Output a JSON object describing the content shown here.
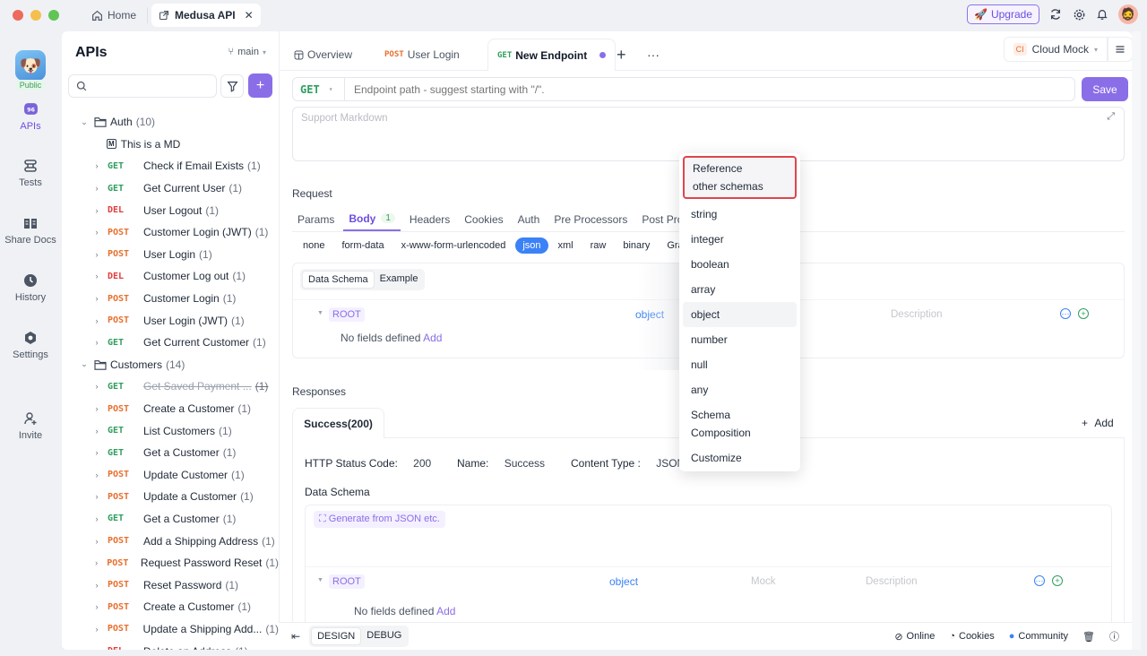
{
  "window": {
    "tabs": [
      {
        "label": "Home",
        "icon": "home-icon"
      },
      {
        "label": "Medusa API",
        "icon": "external-link-icon",
        "active": true
      }
    ],
    "upgrade_label": "Upgrade"
  },
  "rail": {
    "public_badge": "Public",
    "items": [
      {
        "label": "APIs",
        "icon": "api-icon",
        "active": true
      },
      {
        "label": "Tests",
        "icon": "tests-icon"
      },
      {
        "label": "Share Docs",
        "icon": "book-icon"
      },
      {
        "label": "History",
        "icon": "clock-icon"
      },
      {
        "label": "Settings",
        "icon": "settings-icon"
      },
      {
        "label": "Invite",
        "icon": "invite-user-icon"
      }
    ]
  },
  "sidebar": {
    "title": "APIs",
    "branch": "main",
    "search_placeholder": "",
    "tree": [
      {
        "type": "folder",
        "label": "Auth",
        "count": "(10)",
        "expanded": true
      },
      {
        "type": "doc",
        "label": "This is a MD"
      },
      {
        "type": "api",
        "method": "GET",
        "label": "Check if Email Exists",
        "count": "(1)"
      },
      {
        "type": "api",
        "method": "GET",
        "label": "Get Current User",
        "count": "(1)"
      },
      {
        "type": "api",
        "method": "DEL",
        "label": "User Logout",
        "count": "(1)"
      },
      {
        "type": "api",
        "method": "POST",
        "label": "Customer Login (JWT)",
        "count": "(1)"
      },
      {
        "type": "api",
        "method": "POST",
        "label": "User Login",
        "count": "(1)"
      },
      {
        "type": "api",
        "method": "DEL",
        "label": "Customer Log out",
        "count": "(1)"
      },
      {
        "type": "api",
        "method": "POST",
        "label": "Customer Login",
        "count": "(1)"
      },
      {
        "type": "api",
        "method": "POST",
        "label": "User Login (JWT)",
        "count": "(1)"
      },
      {
        "type": "api",
        "method": "GET",
        "label": "Get Current Customer",
        "count": "(1)"
      },
      {
        "type": "folder",
        "label": "Customers",
        "count": "(14)",
        "expanded": true
      },
      {
        "type": "api",
        "method": "GET",
        "label": "Get Saved Payment ...",
        "count": "(1)",
        "deprecated": true
      },
      {
        "type": "api",
        "method": "POST",
        "label": "Create a Customer",
        "count": "(1)"
      },
      {
        "type": "api",
        "method": "GET",
        "label": "List Customers",
        "count": "(1)"
      },
      {
        "type": "api",
        "method": "GET",
        "label": "Get a Customer",
        "count": "(1)"
      },
      {
        "type": "api",
        "method": "POST",
        "label": "Update Customer",
        "count": "(1)"
      },
      {
        "type": "api",
        "method": "POST",
        "label": "Update a Customer",
        "count": "(1)"
      },
      {
        "type": "api",
        "method": "GET",
        "label": "Get a Customer",
        "count": "(1)"
      },
      {
        "type": "api",
        "method": "POST",
        "label": "Add a Shipping Address",
        "count": "(1)"
      },
      {
        "type": "api",
        "method": "POST",
        "label": "Request Password Reset",
        "count": "(1)"
      },
      {
        "type": "api",
        "method": "POST",
        "label": "Reset Password",
        "count": "(1)"
      },
      {
        "type": "api",
        "method": "POST",
        "label": "Create a Customer",
        "count": "(1)"
      },
      {
        "type": "api",
        "method": "POST",
        "label": "Update a Shipping Add...",
        "count": "(1)"
      },
      {
        "type": "api",
        "method": "DEL",
        "label": "Delete an Address",
        "count": "(1)"
      }
    ]
  },
  "main": {
    "tabs": [
      {
        "label": "Overview",
        "icon": "overview-icon"
      },
      {
        "method": "POST",
        "label": "User Login"
      },
      {
        "method": "GET",
        "label": "New Endpoint",
        "active": true,
        "unsaved": true
      }
    ],
    "environment": {
      "badge": "CI",
      "label": "Cloud Mock"
    },
    "method": "GET",
    "path_placeholder": "Endpoint path - suggest starting with \"/\".",
    "save_label": "Save",
    "description_placeholder": "Support Markdown",
    "request_label": "Request",
    "request_tabs": [
      {
        "label": "Params"
      },
      {
        "label": "Body",
        "badge": "1",
        "active": true
      },
      {
        "label": "Headers"
      },
      {
        "label": "Cookies"
      },
      {
        "label": "Auth"
      },
      {
        "label": "Pre Processors"
      },
      {
        "label": "Post Processors"
      }
    ],
    "body_types": [
      "none",
      "form-data",
      "x-www-form-urlencoded",
      "json",
      "xml",
      "raw",
      "binary",
      "GraphQL"
    ],
    "body_type_selected": "json",
    "schema_tabs": [
      "Data Schema",
      "Example"
    ],
    "request_schema": {
      "root_label": "ROOT",
      "type": "object",
      "description_placeholder": "Description",
      "empty_text": "No fields defined",
      "add_link": "Add"
    },
    "responses_label": "Responses",
    "response_tab": "Success(200)",
    "response_add": "Add",
    "response": {
      "status_code_label": "HTTP Status Code:",
      "status_code": "200",
      "name_label": "Name:",
      "name": "Success",
      "content_type_label": "Content Type :",
      "content_type": "JSON",
      "data_schema_label": "Data Schema",
      "generate_label": "Generate from JSON etc.",
      "root_label": "ROOT",
      "type": "object",
      "mock_placeholder": "Mock",
      "description_placeholder": "Description",
      "empty_text": "No fields defined",
      "add_link": "Add"
    }
  },
  "type_dropdown": {
    "items": [
      {
        "label": "Reference other schemas",
        "highlighted_box": true
      },
      {
        "label": "string"
      },
      {
        "label": "integer"
      },
      {
        "label": "boolean"
      },
      {
        "label": "array"
      },
      {
        "label": "object",
        "selected": true
      },
      {
        "label": "number"
      },
      {
        "label": "null"
      },
      {
        "label": "any"
      },
      {
        "label": "Schema Composition"
      },
      {
        "label": "Customize"
      }
    ]
  },
  "bottom_bar": {
    "modes": [
      "DESIGN",
      "DEBUG"
    ],
    "active_mode": "DESIGN",
    "status": [
      {
        "label": "Online",
        "icon": "online-check-icon"
      },
      {
        "label": "Cookies",
        "icon": "cookie-icon"
      },
      {
        "label": "Community",
        "icon": "community-icon"
      }
    ]
  },
  "colors": {
    "accent": "#8a6ee8",
    "get": "#2f9e5e",
    "post": "#e86f2d",
    "del": "#e03c3c",
    "json_active": "#3b82f6",
    "highlight_border": "#e0444b"
  }
}
